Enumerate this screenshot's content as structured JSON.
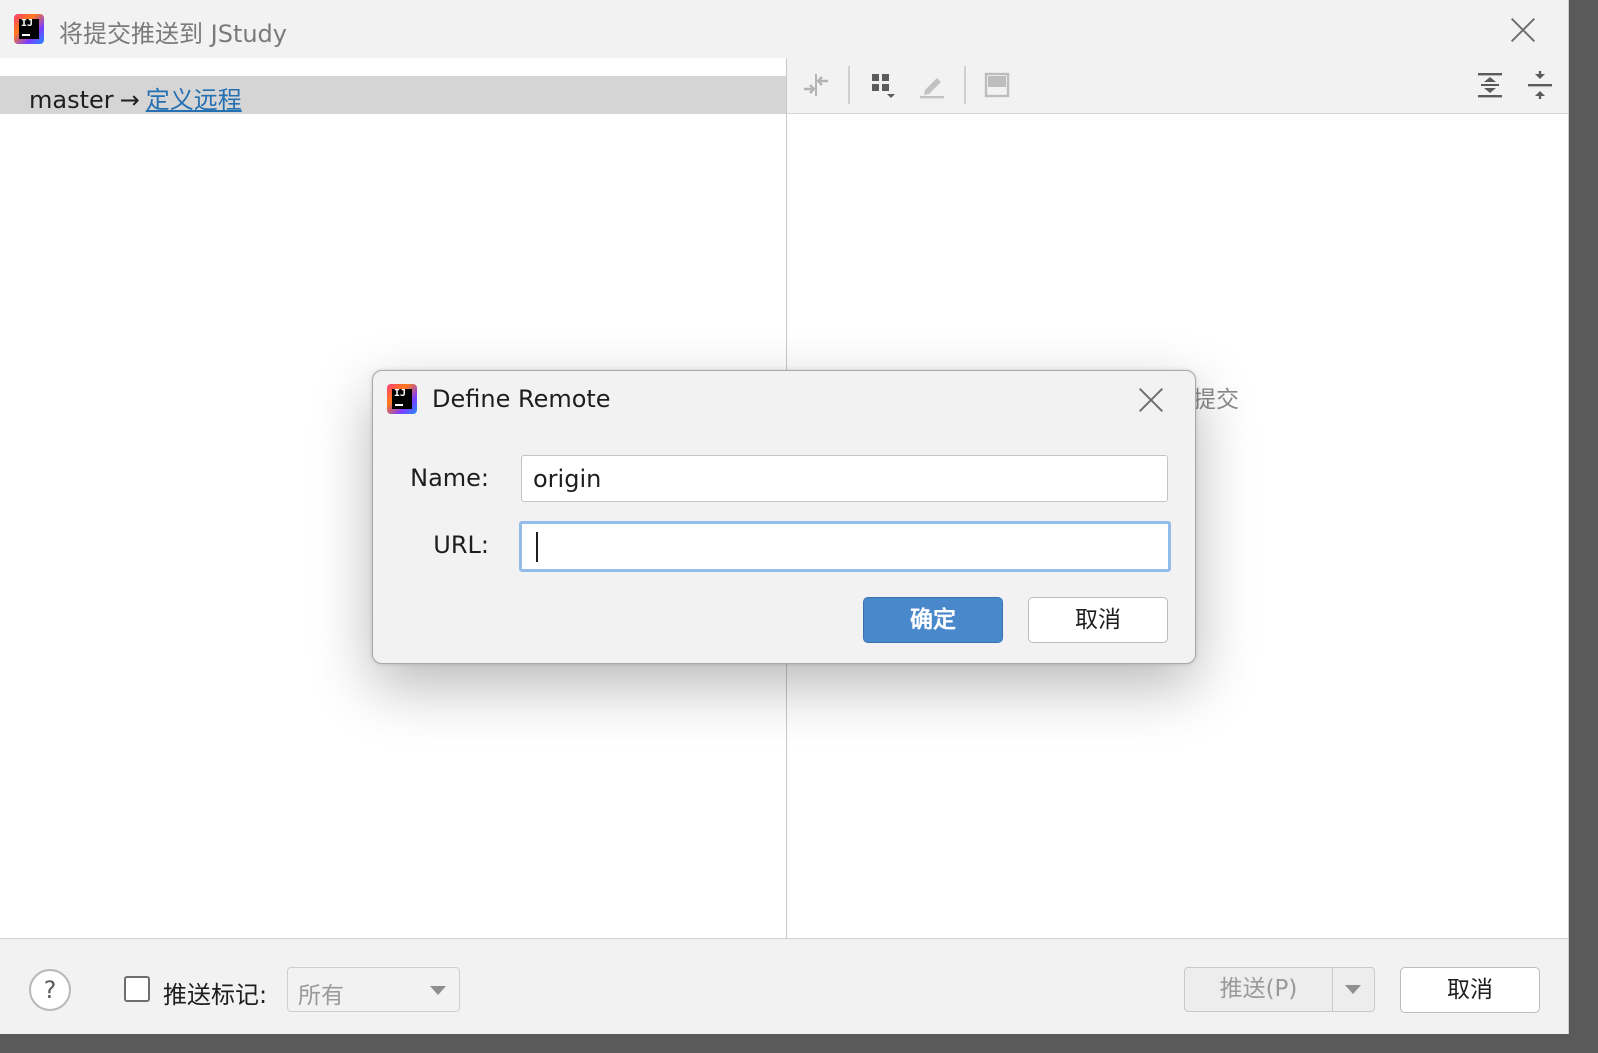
{
  "window": {
    "title": "将提交推送到 JStudy",
    "app_icon": "intellij-idea-icon",
    "close_icon": "close-icon"
  },
  "left_panel": {
    "branch": "master",
    "arrow": "→",
    "define_remote_link": "定义远程"
  },
  "right_panel": {
    "toolbar_icons": [
      "merge-arrows-icon",
      "group-by-icon",
      "edit-icon",
      "preview-pane-icon",
      "expand-all-icon",
      "collapse-all-icon"
    ],
    "empty_hint_partial": "提交"
  },
  "bottom_bar": {
    "help_label": "?",
    "push_tags_label": "推送标记:",
    "push_tags_checked": false,
    "tags_select_value": "所有",
    "push_button": "推送(P)",
    "cancel_button": "取消"
  },
  "dialog": {
    "title": "Define Remote",
    "name_label": "Name:",
    "name_value": "origin",
    "url_label": "URL:",
    "url_value": "",
    "ok_button": "确定",
    "cancel_button": "取消"
  },
  "colors": {
    "accent": "#4a88cc",
    "link": "#2470b3",
    "focus_ring": "#93bde8"
  }
}
